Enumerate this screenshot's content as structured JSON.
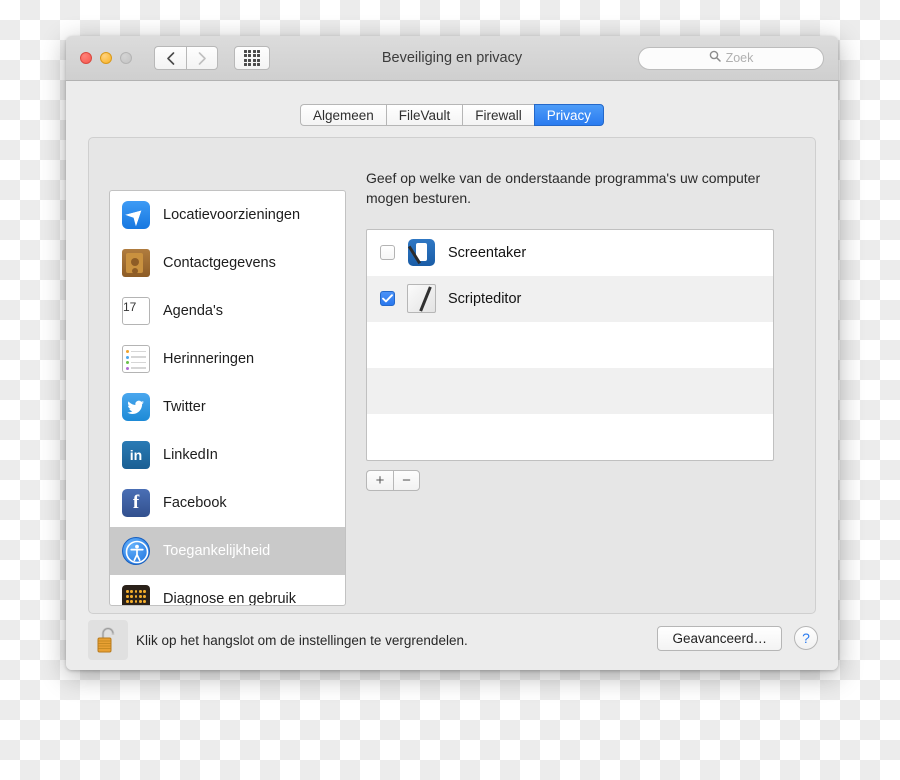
{
  "window": {
    "title": "Beveiliging en privacy",
    "traffic_lights": [
      "close",
      "minimize",
      "zoom"
    ],
    "nav": {
      "back_icon": "chevron-left-icon",
      "forward_icon": "chevron-right-icon",
      "grid_icon": "show-all-grid-icon"
    },
    "search": {
      "placeholder": "Zoek",
      "value": "",
      "icon": "search-icon"
    }
  },
  "tabs": [
    {
      "label": "Algemeen",
      "active": false
    },
    {
      "label": "FileVault",
      "active": false
    },
    {
      "label": "Firewall",
      "active": false
    },
    {
      "label": "Privacy",
      "active": true
    }
  ],
  "sidebar": {
    "items": [
      {
        "label": "Locatievoorzieningen",
        "icon": "location-services-icon",
        "selected": false
      },
      {
        "label": "Contactgegevens",
        "icon": "contacts-icon",
        "selected": false
      },
      {
        "label": "Agenda's",
        "icon": "calendar-icon",
        "selected": false,
        "calendar_day": "17"
      },
      {
        "label": "Herinneringen",
        "icon": "reminders-icon",
        "selected": false
      },
      {
        "label": "Twitter",
        "icon": "twitter-icon",
        "selected": false
      },
      {
        "label": "LinkedIn",
        "icon": "linkedin-icon",
        "selected": false,
        "glyph": "in"
      },
      {
        "label": "Facebook",
        "icon": "facebook-icon",
        "selected": false,
        "glyph": "f"
      },
      {
        "label": "Toegankelijkheid",
        "icon": "accessibility-icon",
        "selected": true
      },
      {
        "label": "Diagnose en gebruik",
        "icon": "diagnostics-usage-icon",
        "selected": false
      }
    ]
  },
  "main": {
    "description": "Geef op welke van de onderstaande programma's uw computer mogen besturen.",
    "apps": [
      {
        "name": "Screentaker",
        "checked": false,
        "icon": "screentaker-app-icon"
      },
      {
        "name": "Scripteditor",
        "checked": true,
        "icon": "script-editor-app-icon"
      }
    ],
    "empty_rows": 3,
    "add_label": "+",
    "remove_label": "−"
  },
  "footer": {
    "lock_icon": "padlock-unlocked-icon",
    "lock_note": "Klik op het hangslot om de instellingen te vergrendelen.",
    "advanced_label": "Geavanceerd…",
    "help_label": "?"
  },
  "colors": {
    "accent_blue": "#2a7bf0",
    "selected_row": "#c9c9c9",
    "window_body": "#ececec",
    "panel": "#e6e6e6"
  }
}
